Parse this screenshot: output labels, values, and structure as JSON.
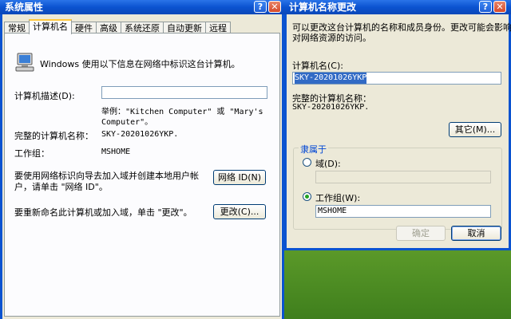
{
  "system_properties": {
    "title": "系统属性",
    "tabs": [
      "常规",
      "计算机名",
      "硬件",
      "高级",
      "系统还原",
      "自动更新",
      "远程"
    ],
    "active_tab": "计算机名",
    "intro_text": "Windows 使用以下信息在网络中标识这台计算机。",
    "description_label": "计算机描述(D):",
    "description_value": "",
    "example_line1": "举例：\"Kitchen Computer\" 或 \"Mary's",
    "example_line2": "Computer\"。",
    "full_name_label": "完整的计算机名称：",
    "full_name_value": "SKY-20201026YKP.",
    "workgroup_label": "工作组：",
    "workgroup_value": "MSHOME",
    "network_id_text_line1": "要使用网络标识向导去加入域并创建本地用户帐",
    "network_id_text_line2": "户，请单击 \"网络 ID\"。",
    "network_id_button": "网络 ID(N)",
    "rename_text": "要重新命名此计算机或加入域，单击 \"更改\"。",
    "change_button": "更改(C)..."
  },
  "computer_name_changes": {
    "title": "计算机名称更改",
    "intro_line1": "可以更改这台计算机的名称和成员身份。更改可能会影响",
    "intro_line2": "对网络资源的访问。",
    "name_label": "计算机名(C):",
    "name_value": "SKY-20201026YKP",
    "full_name_label": "完整的计算机名称：",
    "full_name_value": "SKY-20201026YKP.",
    "other_button": "其它(M)...",
    "member_of_label": "隶属于",
    "domain_label": "域(D):",
    "domain_value": "",
    "workgroup_label": "工作组(W):",
    "workgroup_value": "MSHOME",
    "ok_button": "确定",
    "cancel_button": "取消"
  }
}
